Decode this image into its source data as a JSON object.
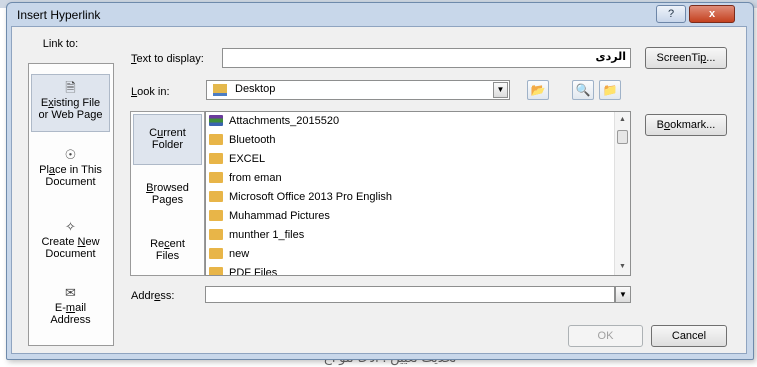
{
  "dialog": {
    "title": "Insert Hyperlink",
    "help_button": "?",
    "close_button": "x"
  },
  "link_to": {
    "label": "Link to:",
    "items": [
      {
        "pre": "E",
        "u": "x",
        "post": "isting File",
        "line2": "or Web Page",
        "icon": "existing-file-icon",
        "selected": true
      },
      {
        "pre": "Pl",
        "u": "a",
        "post": "ce in This",
        "line2": "Document",
        "icon": "place-in-document-icon",
        "selected": false
      },
      {
        "pre": "Create ",
        "u": "N",
        "post": "ew",
        "line2": "Document",
        "icon": "new-document-icon",
        "selected": false
      },
      {
        "pre": "E-",
        "u": "m",
        "post": "ail",
        "line2": "Address",
        "icon": "email-icon",
        "selected": false
      }
    ]
  },
  "text_to_display": {
    "label_underline": "T",
    "label_rest": "ext to display:",
    "value": "الردى"
  },
  "screentip_button": {
    "pre": "ScreenTi",
    "u": "p",
    "post": "..."
  },
  "look_in": {
    "label_underline": "L",
    "label_rest": "ook in:",
    "value": "Desktop"
  },
  "places": [
    {
      "line1_pre": "C",
      "line1_u": "u",
      "line1_post": "rrent",
      "line2": "Folder",
      "selected": true
    },
    {
      "line1_pre": "",
      "line1_u": "B",
      "line1_post": "rowsed",
      "line2": "Pages",
      "selected": false
    },
    {
      "line1_pre": "Re",
      "line1_u": "c",
      "line1_post": "ent",
      "line2": "Files",
      "selected": false
    }
  ],
  "files": [
    {
      "name": "Attachments_2015520",
      "type": "zip"
    },
    {
      "name": "Bluetooth",
      "type": "folder"
    },
    {
      "name": "EXCEL",
      "type": "folder"
    },
    {
      "name": "from eman",
      "type": "folder"
    },
    {
      "name": "Microsoft Office 2013 Pro  English",
      "type": "folder"
    },
    {
      "name": "Muhammad Pictures",
      "type": "folder"
    },
    {
      "name": "munther 1_files",
      "type": "folder"
    },
    {
      "name": "new",
      "type": "folder"
    },
    {
      "name": "PDF Files",
      "type": "folder"
    }
  ],
  "bookmark_button": {
    "pre": "B",
    "u": "o",
    "post": "okmark..."
  },
  "address": {
    "label_pre": "Addr",
    "label_u": "e",
    "label_post": "ss:",
    "value": ""
  },
  "ok_button": "OK",
  "cancel_button": "Cancel",
  "background_text": "تحديث تعيين ؛ ادخا تلو اخ",
  "colors": {
    "title_bar": "#c8d7ea",
    "close": "#c4411f",
    "folder": "#e8b548"
  }
}
